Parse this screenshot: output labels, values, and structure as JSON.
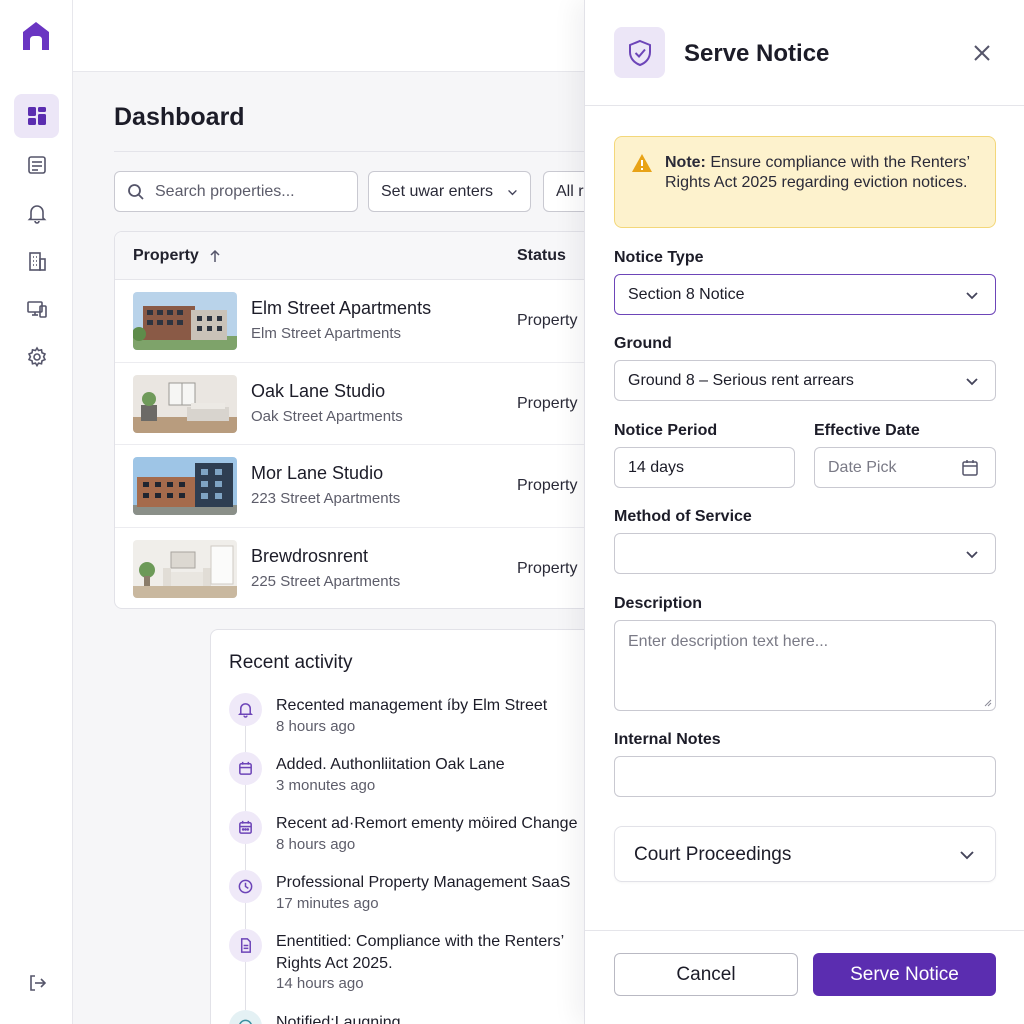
{
  "app": {
    "brand_color": "#5b2db0",
    "icons": [
      "app-logo-icon",
      "dashboard-icon",
      "document-list-icon",
      "bell-icon",
      "building-icon",
      "devices-icon",
      "gear-icon",
      "logout-icon"
    ]
  },
  "dashboard": {
    "title": "Dashboard",
    "search_placeholder": "Search properties...",
    "filters": [
      "Set uwar enters",
      "All r"
    ],
    "table": {
      "columns": [
        "Property",
        "Status"
      ],
      "rows": [
        {
          "name": "Elm Street Apartments",
          "address": "Elm Street Apartments",
          "status": "Property"
        },
        {
          "name": "Oak Lane Studio",
          "address": "Oak Street Apartments",
          "status": "Property"
        },
        {
          "name": "Mor Lane Studio",
          "address": "223 Street Apartments",
          "status": "Property"
        },
        {
          "name": "Brewdrosnrent",
          "address": "225 Street Apartments",
          "status": "Property"
        }
      ]
    },
    "activity": {
      "title": "Recent activity",
      "items": [
        {
          "icon": "bell-icon",
          "text": "Recented management íby Elm Street",
          "time": "8 hours ago"
        },
        {
          "icon": "calendar-icon",
          "text": "Added. Authonliitation Oak Lane",
          "time": "3 monutes ago"
        },
        {
          "icon": "calendar-grid-icon",
          "text": "Recent ad·Remort ementy möired Change",
          "time": "8 hours ago"
        },
        {
          "icon": "clock-icon",
          "text": "Professional Property Management SaaS",
          "time": "17 minutes ago"
        },
        {
          "icon": "document-icon",
          "text": "Enentitied: Compliance with the Renters’",
          "text2": " Rights Act 2025.",
          "time": "14 hours ago"
        },
        {
          "icon": "globe-icon",
          "text": "Notified:Laugning",
          "time": ""
        }
      ]
    }
  },
  "panel": {
    "title": "Serve Notice",
    "note_label": "Note:",
    "note_text": " Ensure compliance with the Renters’ Rights Act 2025 regarding eviction notices.",
    "fields": {
      "notice_type_label": "Notice Type",
      "notice_type_value": "Section 8 Notice",
      "ground_label": "Ground",
      "ground_value": "Ground 8 – Serious rent arrears",
      "notice_period_label": "Notice Period",
      "notice_period_value": "14 days",
      "effective_date_label": "Effective Date",
      "effective_date_placeholder": "Date Pick",
      "method_label": "Method of Service",
      "method_value": "",
      "description_label": "Description",
      "description_placeholder": "Enter description text here...",
      "internal_notes_label": "Internal Notes",
      "internal_notes_value": ""
    },
    "accordion_label": "Court Proceedings",
    "cancel_label": "Cancel",
    "submit_label": "Serve Notice"
  }
}
